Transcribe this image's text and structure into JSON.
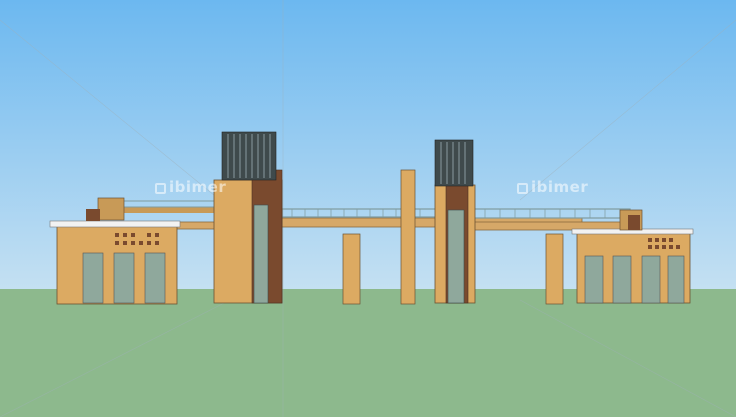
{
  "viewport": {
    "title": "",
    "watermarks": [
      {
        "text": "ibimer",
        "icon": "bimer-logo-icon"
      },
      {
        "text": "ibimer",
        "icon": "bimer-logo-icon"
      }
    ]
  },
  "colors": {
    "sky_top": "#6cb8f0",
    "sky_bottom": "#c4e0f2",
    "ground": "#8db98d",
    "wall": "#dcaa62",
    "wall_shade": "#c89a57",
    "tower_core": "#7a4a2e",
    "glass": "#8fa89c",
    "dark_grille": "#3f4a4c",
    "bridge": "#d6a868",
    "railing": "#7f9b9f",
    "roof": "#f2f2f2"
  }
}
